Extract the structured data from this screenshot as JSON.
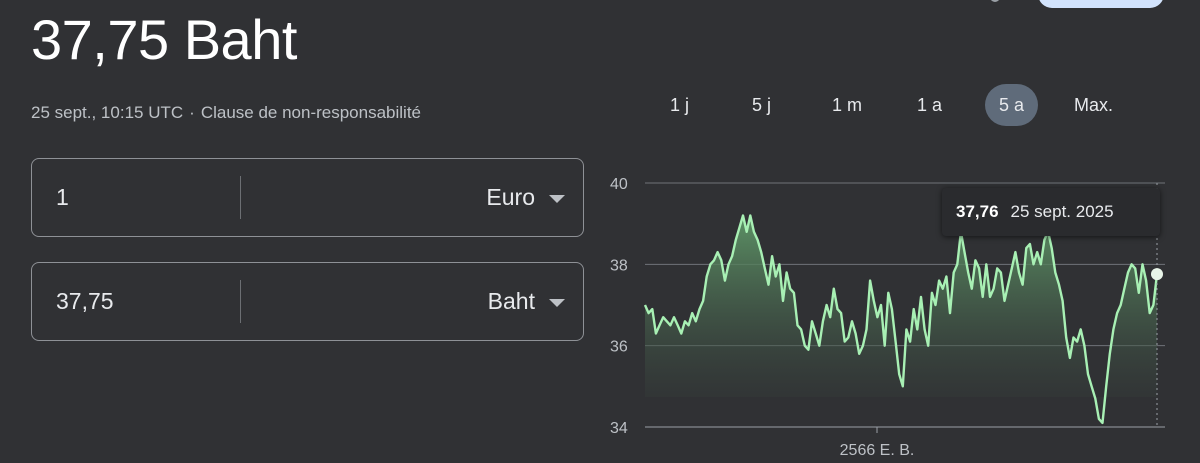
{
  "header": {
    "rate_display": "37,75 Baht",
    "timestamp": "25 sept., 10:15 UTC",
    "separator": "·",
    "disclaimer": "Clause de non-responsabilité"
  },
  "converter": {
    "from": {
      "amount": "1",
      "currency": "Euro"
    },
    "to": {
      "amount": "37,75",
      "currency": "Baht"
    }
  },
  "range_tabs": [
    {
      "label": "1 j"
    },
    {
      "label": "5 j"
    },
    {
      "label": "1 m"
    },
    {
      "label": "1 a"
    },
    {
      "label": "5 a",
      "active": true
    },
    {
      "label": "Max."
    }
  ],
  "tooltip": {
    "value": "37,76",
    "date": "25 sept. 2025"
  },
  "colors": {
    "background": "#303134",
    "line": "#a8f0b4",
    "fill_top": "#5f9868",
    "gridline": "#7b7f84",
    "active_tab": "#5f6b7a"
  },
  "chart_data": {
    "type": "area",
    "ylim": [
      34,
      40
    ],
    "yticks": [
      "40",
      "38",
      "36",
      "34"
    ],
    "xlabel_tick": "2566 E. B.",
    "grid": true,
    "values": [
      37.0,
      36.8,
      36.9,
      36.3,
      36.5,
      36.7,
      36.6,
      36.5,
      36.7,
      36.5,
      36.3,
      36.6,
      36.5,
      36.8,
      36.6,
      36.9,
      37.1,
      37.7,
      38.0,
      38.1,
      38.3,
      38.1,
      37.6,
      38.0,
      38.2,
      38.6,
      38.9,
      39.2,
      38.8,
      39.2,
      38.8,
      38.6,
      38.3,
      37.9,
      37.5,
      38.2,
      37.7,
      38.0,
      37.1,
      37.8,
      37.4,
      37.3,
      36.5,
      36.4,
      36.0,
      35.9,
      36.6,
      36.3,
      36.0,
      36.6,
      37.0,
      36.7,
      37.4,
      36.9,
      36.8,
      36.1,
      36.2,
      36.6,
      36.3,
      35.8,
      36.0,
      36.4,
      37.6,
      37.1,
      36.7,
      37.0,
      36.0,
      37.3,
      36.9,
      36.1,
      35.3,
      35.0,
      36.4,
      36.1,
      36.9,
      36.4,
      37.2,
      36.4,
      36.0,
      37.3,
      37.0,
      37.6,
      37.4,
      37.7,
      36.8,
      37.8,
      38.0,
      38.8,
      38.3,
      37.8,
      37.4,
      38.1,
      37.9,
      37.2,
      38.0,
      37.2,
      37.4,
      37.9,
      37.8,
      37.1,
      37.5,
      37.9,
      38.3,
      37.8,
      37.5,
      38.4,
      38.5,
      38.0,
      38.3,
      38.0,
      38.6,
      38.8,
      38.4,
      37.8,
      37.5,
      37.1,
      36.2,
      35.7,
      36.2,
      36.1,
      36.4,
      36.0,
      35.3,
      35.0,
      34.7,
      34.2,
      34.1,
      35.0,
      35.8,
      36.4,
      36.8,
      37.0,
      37.4,
      37.8,
      38.0,
      37.9,
      37.3,
      38.0,
      37.6,
      36.8,
      37.0,
      37.76
    ]
  }
}
